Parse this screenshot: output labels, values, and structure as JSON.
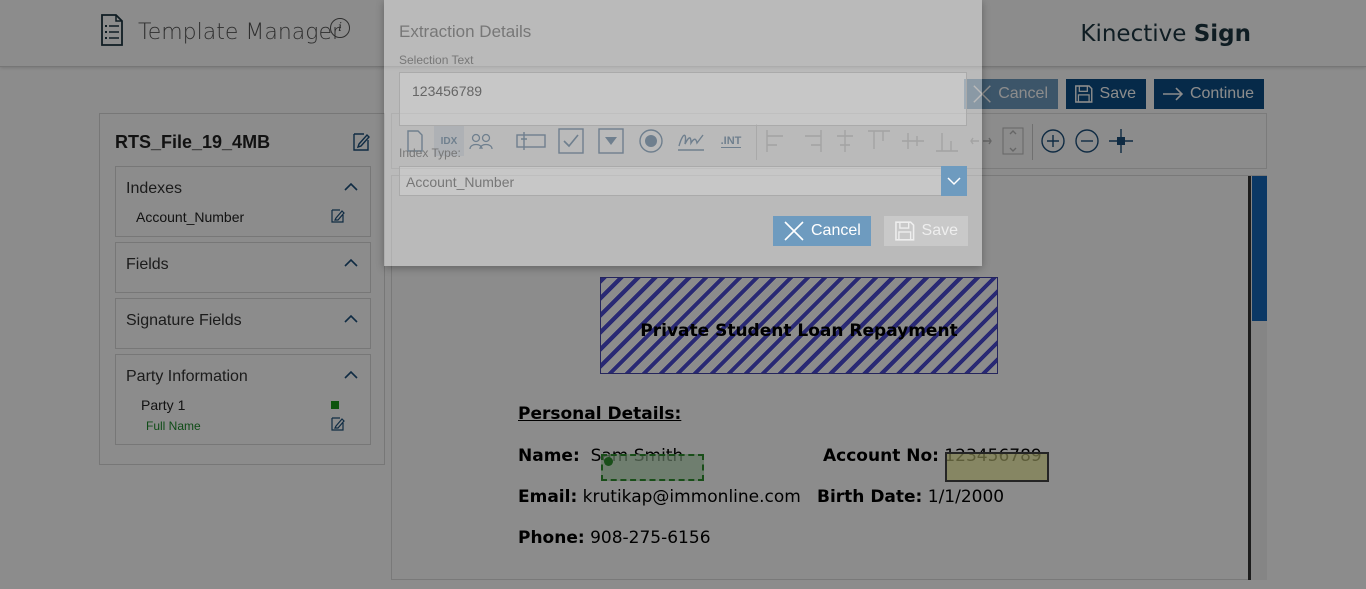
{
  "header": {
    "app_title": "Template Manager",
    "info_glyph": "i",
    "brand_prefix": "Kinective",
    "brand_suffix": "Sign"
  },
  "actions": {
    "cancel": "Cancel",
    "save": "Save",
    "continue": "Continue"
  },
  "left_panel": {
    "file_name": "RTS_File_19_4MB",
    "sections": {
      "indexes": {
        "title": "Indexes",
        "items": [
          "Account_Number"
        ]
      },
      "fields": {
        "title": "Fields"
      },
      "signature_fields": {
        "title": "Signature Fields"
      },
      "party_information": {
        "title": "Party Information",
        "party": "Party 1",
        "party_field": "Full Name",
        "party_color": "#1a9a1a"
      }
    }
  },
  "toolbar": {
    "idx_label": "IDX",
    "int_label": ".INT",
    "icons": [
      "document-icon",
      "index-icon",
      "parties-icon",
      "text-field-icon",
      "checkbox-icon",
      "dropdown-icon",
      "radio-icon",
      "signature-icon",
      "int-icon",
      "align-left-icon",
      "align-right-icon",
      "align-center-icon",
      "align-top-icon",
      "align-middle-icon",
      "align-bottom-icon",
      "distribute-horizontal-icon",
      "distribute-vertical-icon",
      "zoom-in-icon",
      "zoom-out-icon",
      "fit-icon"
    ]
  },
  "document": {
    "title": "Private Student Loan Repayment",
    "section_heading": "Personal Details:",
    "name_label": "Name:",
    "name_value": "Sam Smith",
    "account_label": "Account No:",
    "account_value": "123456789",
    "email_label": "Email:",
    "email_value": "krutikap@immonline.com",
    "birth_label": "Birth Date:",
    "birth_value": "1/1/2000",
    "phone_label": "Phone:",
    "phone_value": "908-275-6156"
  },
  "modal": {
    "title": "Extraction Details",
    "selection_label": "Selection Text",
    "selection_value": "123456789",
    "index_type_label": "Index Type:",
    "index_type_value": "Account_Number",
    "cancel_label": "Cancel",
    "save_label": "Save"
  },
  "colors": {
    "primary": "#0b4e86",
    "primary_light": "#6e9bbf",
    "accent_green": "#1d8a2a"
  }
}
